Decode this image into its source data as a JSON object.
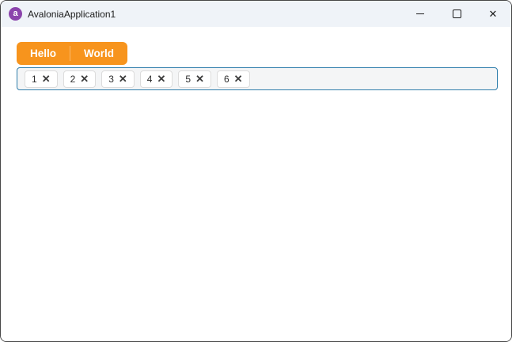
{
  "window": {
    "title": "AvaloniaApplication1",
    "app_icon_glyph": "a",
    "controls": {
      "minimize": "minimize",
      "maximize": "maximize",
      "close": "close",
      "close_glyph": "✕"
    }
  },
  "colors": {
    "titlebar_bg": "#eff3f8",
    "accent_orange": "#f7941d",
    "tagbox_border": "#2e7dab",
    "tagbox_bg": "#f4f5f6",
    "app_icon_purple": "#8b44ac"
  },
  "toolbar": {
    "buttons": [
      {
        "label": "Hello"
      },
      {
        "label": "World"
      }
    ]
  },
  "tagbox": {
    "remove_glyph": "✕",
    "tags": [
      {
        "label": "1"
      },
      {
        "label": "2"
      },
      {
        "label": "3"
      },
      {
        "label": "4"
      },
      {
        "label": "5"
      },
      {
        "label": "6"
      }
    ]
  }
}
